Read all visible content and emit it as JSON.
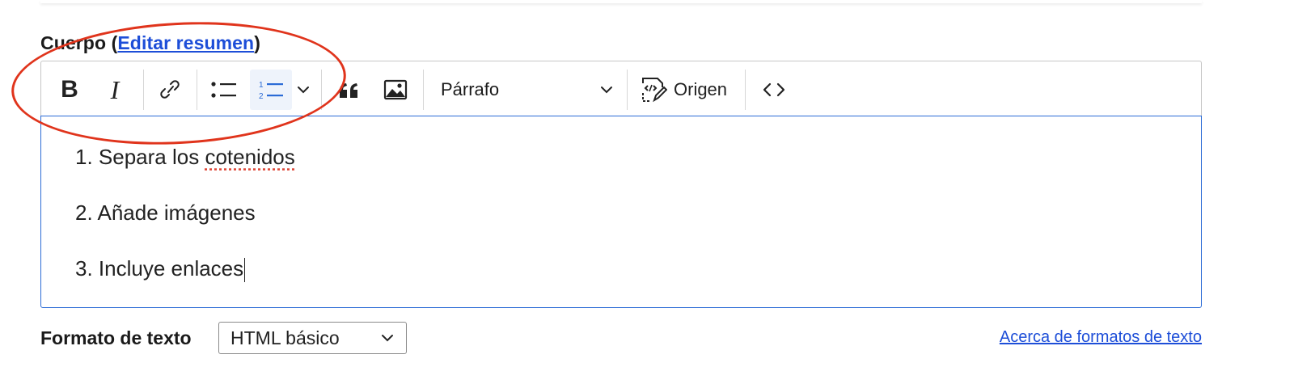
{
  "field": {
    "label_prefix": "Cuerpo (",
    "link": "Editar resumen",
    "label_suffix": ")"
  },
  "toolbar": {
    "bold": "B",
    "italic": "I",
    "heading_value": "Párrafo",
    "source_label": "Origen",
    "icons": [
      "bold-icon",
      "italic-icon",
      "link-icon",
      "bulleted-list-icon",
      "numbered-list-icon",
      "chevron-down-icon",
      "blockquote-icon",
      "image-icon",
      "source-edit-icon",
      "code-icon"
    ],
    "active": "numbered-list"
  },
  "content": {
    "items": [
      {
        "num": "1.",
        "text_before": "Separa los ",
        "misspelled": "cotenidos",
        "text_after": ""
      },
      {
        "num": "2.",
        "text": "Añade imágenes"
      },
      {
        "num": "3.",
        "text": "Incluye enlaces"
      }
    ]
  },
  "format": {
    "label": "Formato de texto",
    "selected": "HTML básico",
    "about_link": "Acerca de formatos de texto"
  },
  "colors": {
    "link": "#1d4ed8",
    "focus_border": "#2b6bd6",
    "annotation": "#e0341c",
    "active_button_bg": "#eef3fb"
  }
}
